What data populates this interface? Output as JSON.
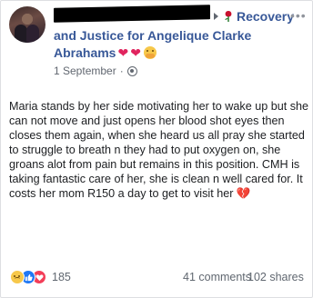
{
  "header": {
    "group_name_line1": "Recovery",
    "group_name_line2": "and Justice for Angelique Clarke",
    "group_name_line3": "Abrahams",
    "more_label": "•••"
  },
  "meta": {
    "date": "1 September",
    "separator": "·"
  },
  "post": {
    "text_main": "Maria stands by her side motivating her to wake up but she can not move and just opens her blood shot eyes then closes them again, when she heard us all pray she started to struggle to breath n they had to put oxygen on, she groans alot from pain but remains in this position. CMH is taking fantastic care of her, she is clean n well cared for. It costs her mom R150 a day to get to visit her",
    "broken_heart": "💔"
  },
  "footer": {
    "reaction_count": "185",
    "comments": "41 comments",
    "shares": "102 shares"
  },
  "icons": {
    "reactions": [
      "sad",
      "like",
      "love"
    ],
    "heart_color": "#e0245e",
    "link_color": "#385898"
  }
}
